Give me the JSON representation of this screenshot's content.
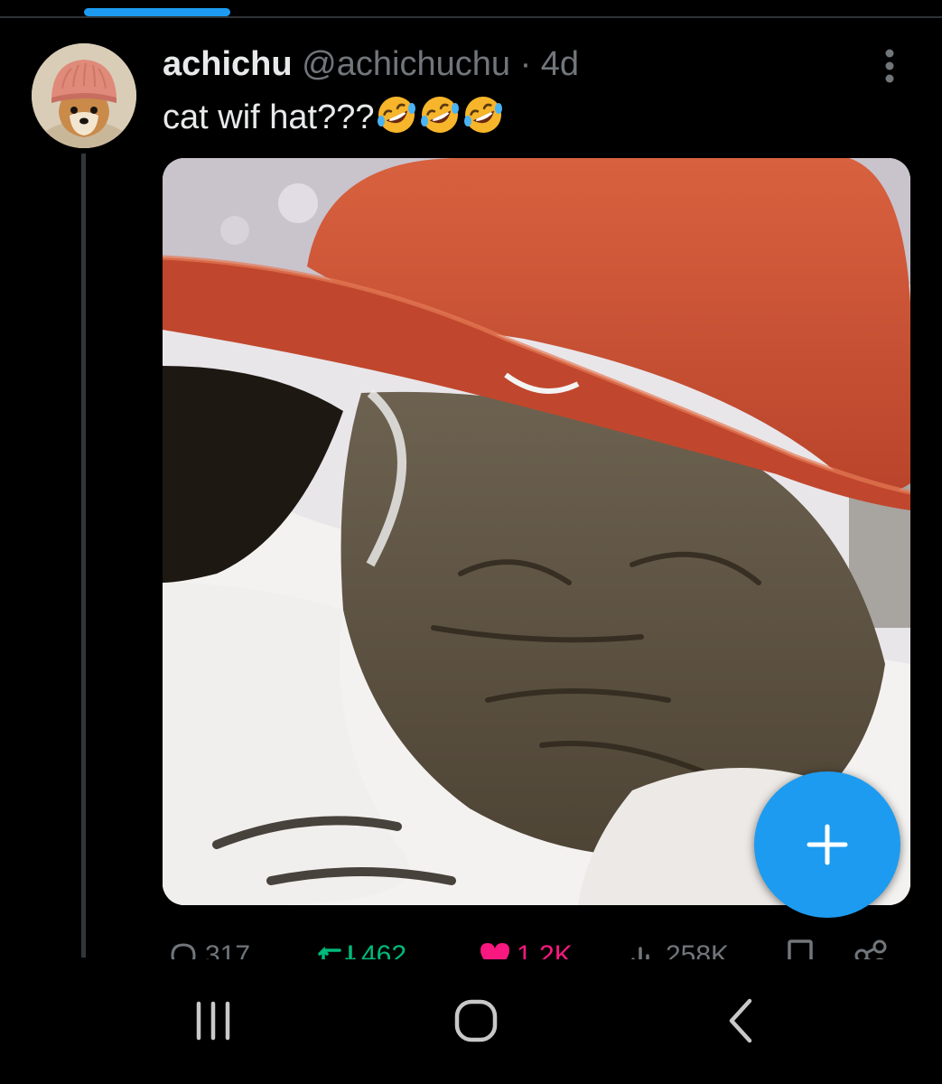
{
  "post": {
    "display_name": "achichu",
    "handle": "@achichuchu",
    "separator": "·",
    "time": "4d",
    "text": "cat wif hat???",
    "emoji_count": 3,
    "emoji_name": "rolling-on-the-floor-laughing-emoji"
  },
  "actions": {
    "replies": "317",
    "reposts": "462",
    "likes": "1.2K",
    "views": "258K"
  },
  "colors": {
    "accent": "#1d9bf0",
    "repost_green": "#00ba7c",
    "like_pink": "#f91880",
    "secondary_text": "#71767b"
  },
  "icons": {
    "more": "vertical-ellipsis-icon",
    "compose": "plus-icon",
    "reply": "speech-bubble-icon",
    "repost": "repost-arrows-icon",
    "like": "heart-icon",
    "views": "bar-chart-icon",
    "bookmark": "bookmark-icon",
    "share": "share-icon",
    "nav_recents": "recent-apps-icon",
    "nav_home": "home-icon",
    "nav_back": "back-chevron-icon"
  }
}
